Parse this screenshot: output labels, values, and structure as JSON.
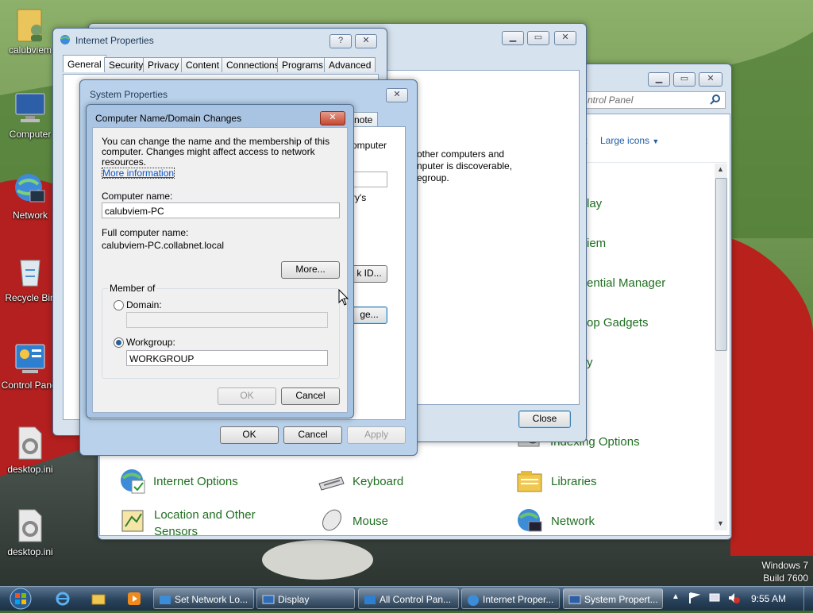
{
  "desktop": {
    "icons": [
      {
        "label": "calubviem"
      },
      {
        "label": "Computer"
      },
      {
        "label": "Network"
      },
      {
        "label": "Recycle Bin"
      },
      {
        "label": "Control Panel"
      },
      {
        "label": "desktop.ini"
      },
      {
        "label": "desktop.ini"
      }
    ],
    "watermark_line1": "Windows 7",
    "watermark_line2": "Build 7600"
  },
  "internet_properties": {
    "title": "Internet Properties",
    "help_glyph": "?",
    "tabs": [
      "General",
      "Security",
      "Privacy",
      "Content",
      "Connections",
      "Programs",
      "Advanced"
    ]
  },
  "back_window": {
    "text_lines": [
      "other computers and",
      "nputer is discoverable,",
      "egroup."
    ],
    "close_button": "Close"
  },
  "control_panel": {
    "search_placeholder": "ntrol Panel",
    "view_by_label": "y:",
    "view_mode": "Large icons",
    "partial_items": [
      "lay",
      "iem",
      "ential Manager",
      "op Gadgets",
      "y"
    ],
    "items": [
      {
        "label": "Internet Options",
        "icon": "globe-check-icon"
      },
      {
        "label": "Keyboard",
        "icon": "keyboard-icon"
      },
      {
        "label": "Libraries",
        "icon": "folder-icon"
      },
      {
        "label": "Location and Other Sensors",
        "line1": "Location and Other",
        "line2": "Sensors",
        "icon": "sensor-icon"
      },
      {
        "label": "Mouse",
        "icon": "mouse-icon"
      },
      {
        "label": "Network",
        "icon": "network-globe-icon"
      },
      {
        "label": "Indexing Options",
        "icon": "indexing-icon"
      }
    ]
  },
  "system_properties": {
    "title": "System Properties",
    "partial_tab": "note",
    "partial_text_1": "omputer",
    "partial_text_2": "ry's",
    "network_id_button": "k ID...",
    "change_button": "ge...",
    "ok": "OK",
    "cancel": "Cancel",
    "apply": "Apply"
  },
  "dialog": {
    "title": "Computer Name/Domain Changes",
    "intro_line1": "You can change the name and the membership of this",
    "intro_line2": "computer. Changes might affect access to network resources.",
    "more_info_link": "More information",
    "computer_name_label": "Computer name:",
    "computer_name_value": "calubviem-PC",
    "full_name_label": "Full computer name:",
    "full_name_value": "calubviem-PC.collabnet.local",
    "more_button": "More...",
    "member_of_label": "Member of",
    "domain_label": "Domain:",
    "domain_value": "",
    "workgroup_label": "Workgroup:",
    "workgroup_value": "WORKGROUP",
    "selected_membership": "workgroup",
    "ok": "OK",
    "cancel": "Cancel"
  },
  "taskbar": {
    "buttons": [
      {
        "label": "Set Network Lo..."
      },
      {
        "label": "Display"
      },
      {
        "label": "All Control Pan..."
      },
      {
        "label": "Internet Proper..."
      },
      {
        "label": "System Propert..."
      }
    ],
    "clock": "9:55 AM"
  }
}
